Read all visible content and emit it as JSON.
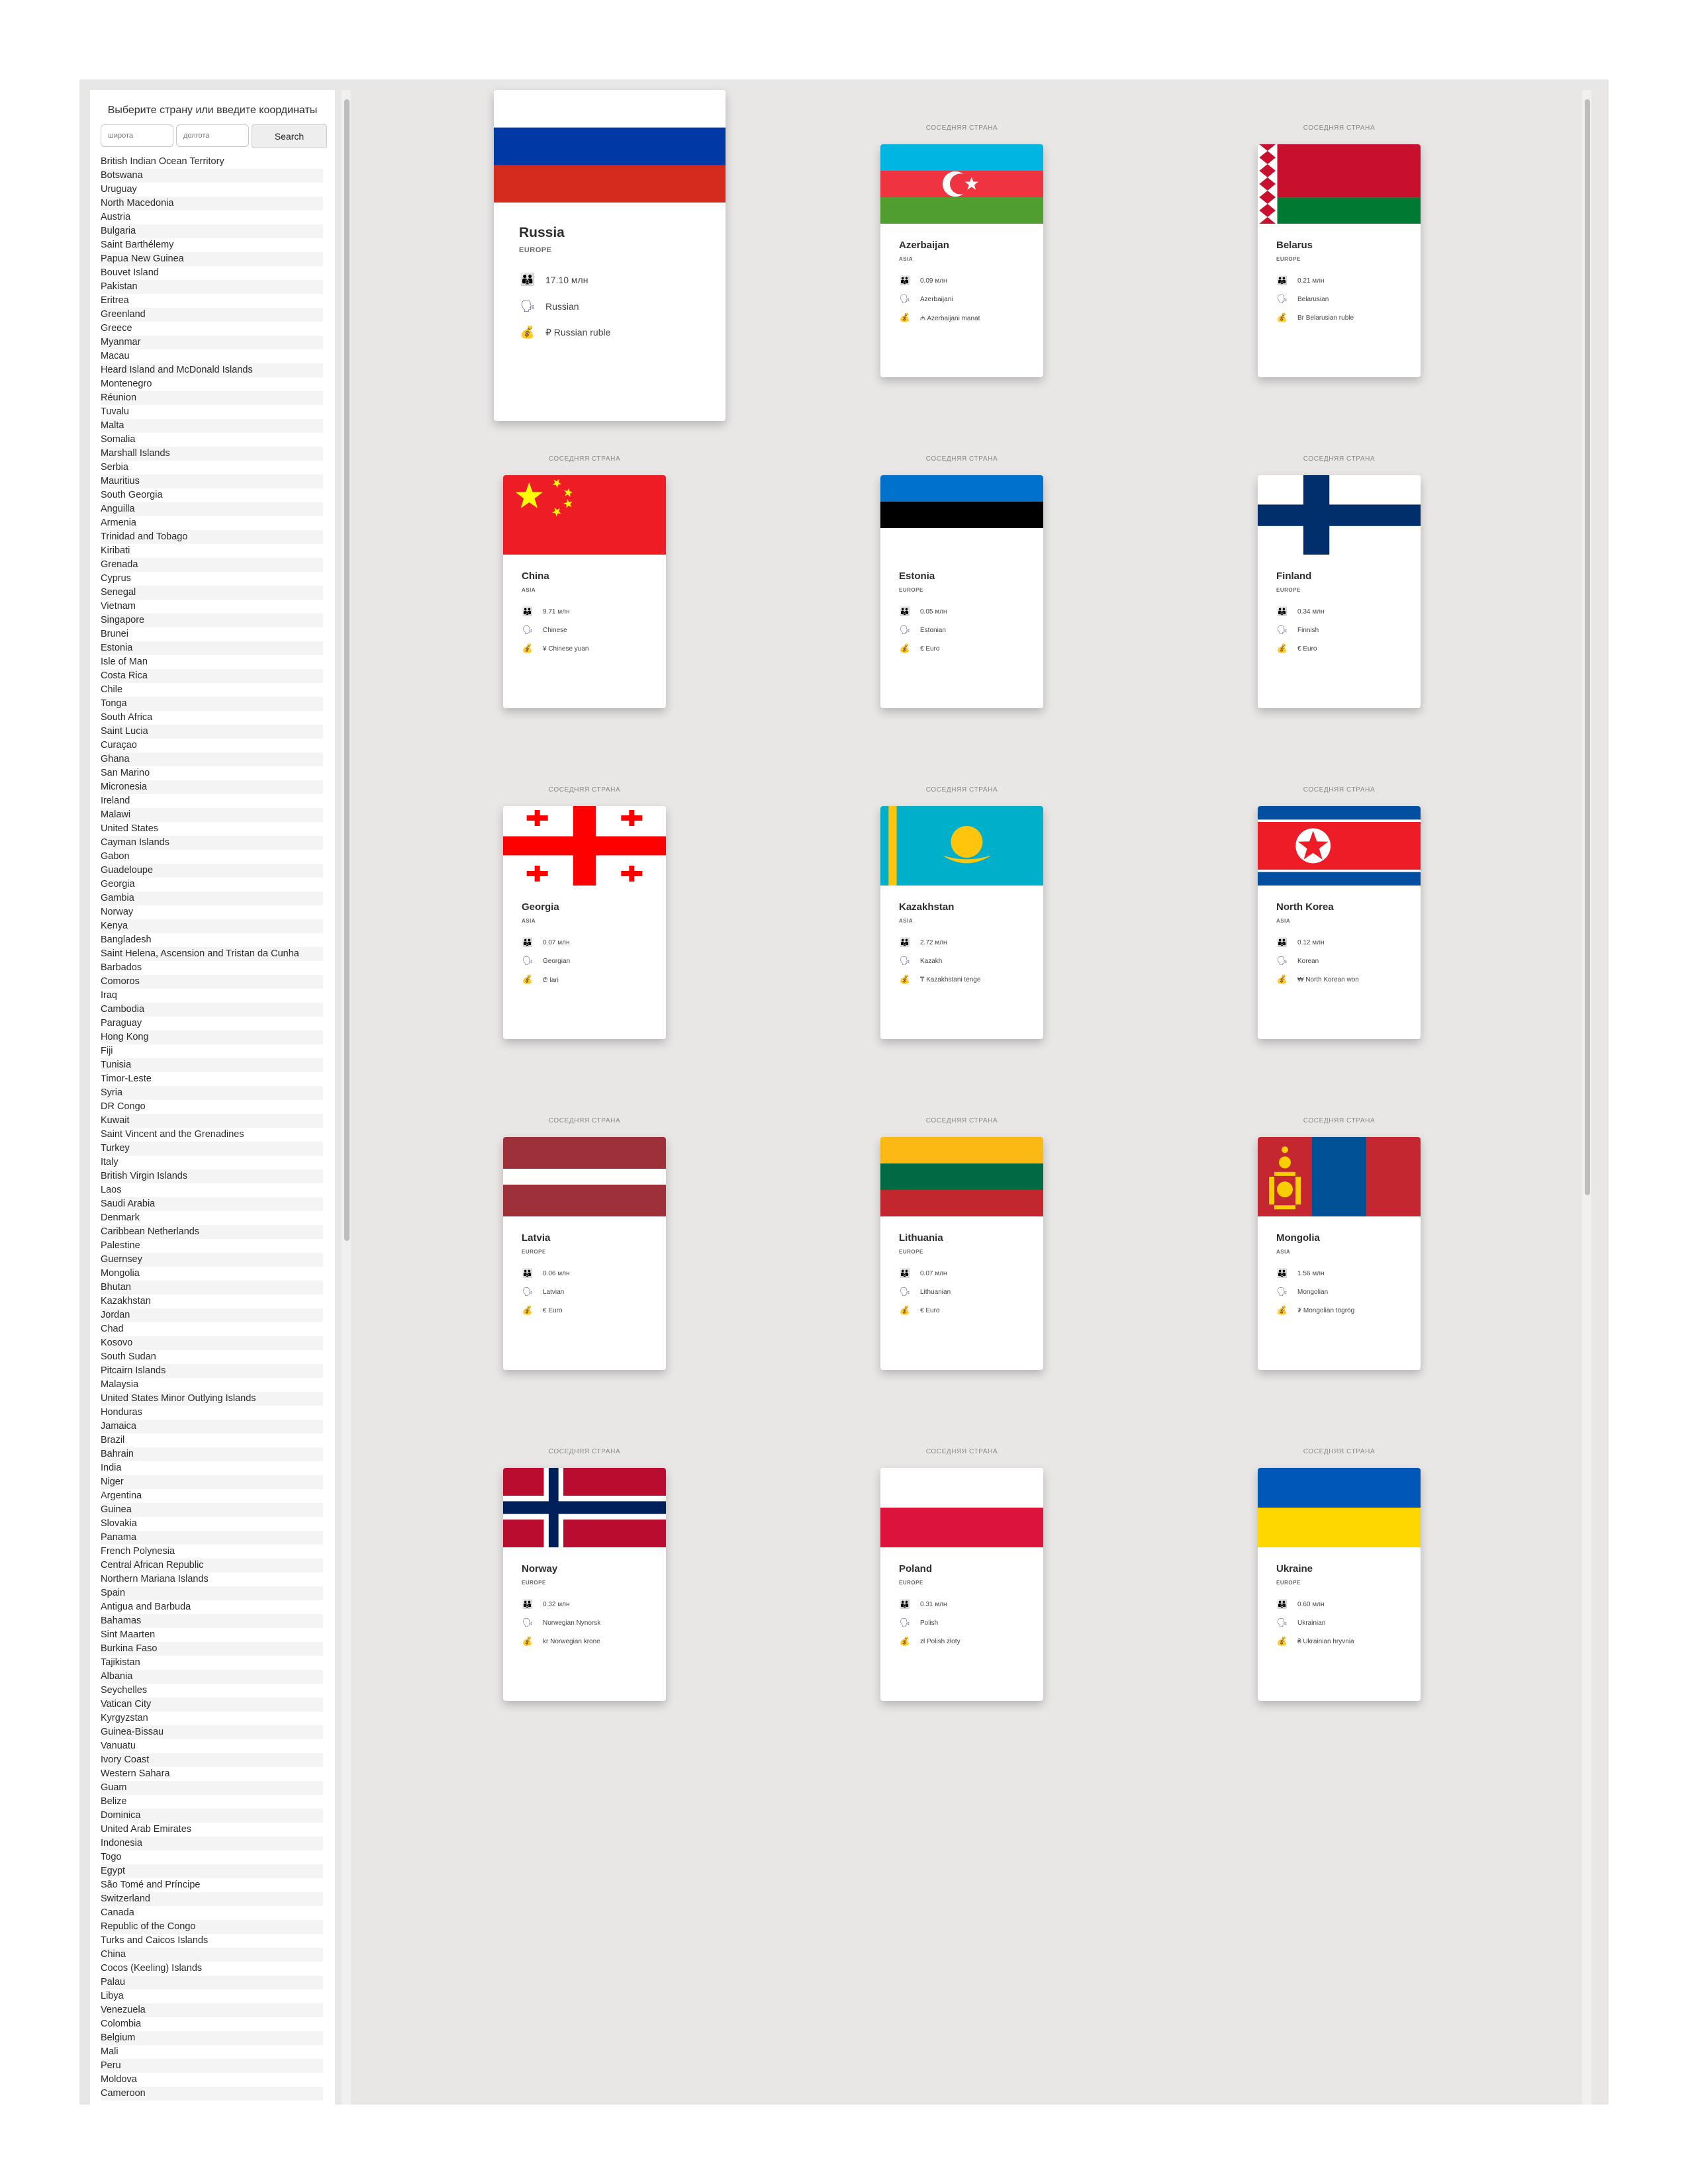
{
  "sidebar": {
    "title": "Выберите страну или введите координаты",
    "lat_placeholder": "широта",
    "lon_placeholder": "долгота",
    "search_label": "Search",
    "countries": [
      "British Indian Ocean Territory",
      "Botswana",
      "Uruguay",
      "North Macedonia",
      "Austria",
      "Bulgaria",
      "Saint Barthélemy",
      "Papua New Guinea",
      "Bouvet Island",
      "Pakistan",
      "Eritrea",
      "Greenland",
      "Greece",
      "Myanmar",
      "Macau",
      "Heard Island and McDonald Islands",
      "Montenegro",
      "Réunion",
      "Tuvalu",
      "Malta",
      "Somalia",
      "Marshall Islands",
      "Serbia",
      "Mauritius",
      "South Georgia",
      "Anguilla",
      "Armenia",
      "Trinidad and Tobago",
      "Kiribati",
      "Grenada",
      "Cyprus",
      "Senegal",
      "Vietnam",
      "Singapore",
      "Brunei",
      "Estonia",
      "Isle of Man",
      "Costa Rica",
      "Chile",
      "Tonga",
      "South Africa",
      "Saint Lucia",
      "Curaçao",
      "Ghana",
      "San Marino",
      "Micronesia",
      "Ireland",
      "Malawi",
      "United States",
      "Cayman Islands",
      "Gabon",
      "Guadeloupe",
      "Georgia",
      "Gambia",
      "Norway",
      "Kenya",
      "Bangladesh",
      "Saint Helena, Ascension and Tristan da Cunha",
      "Barbados",
      "Comoros",
      "Iraq",
      "Cambodia",
      "Paraguay",
      "Hong Kong",
      "Fiji",
      "Tunisia",
      "Timor-Leste",
      "Syria",
      "DR Congo",
      "Kuwait",
      "Saint Vincent and the Grenadines",
      "Turkey",
      "Italy",
      "British Virgin Islands",
      "Laos",
      "Saudi Arabia",
      "Denmark",
      "Caribbean Netherlands",
      "Palestine",
      "Guernsey",
      "Mongolia",
      "Bhutan",
      "Kazakhstan",
      "Jordan",
      "Chad",
      "Kosovo",
      "South Sudan",
      "Pitcairn Islands",
      "Malaysia",
      "United States Minor Outlying Islands",
      "Honduras",
      "Jamaica",
      "Brazil",
      "Bahrain",
      "India",
      "Niger",
      "Argentina",
      "Guinea",
      "Slovakia",
      "Panama",
      "French Polynesia",
      "Central African Republic",
      "Northern Mariana Islands",
      "Spain",
      "Antigua and Barbuda",
      "Bahamas",
      "Sint Maarten",
      "Burkina Faso",
      "Tajikistan",
      "Albania",
      "Seychelles",
      "Vatican City",
      "Kyrgyzstan",
      "Guinea-Bissau",
      "Vanuatu",
      "Ivory Coast",
      "Western Sahara",
      "Guam",
      "Belize",
      "Dominica",
      "United Arab Emirates",
      "Indonesia",
      "Togo",
      "Egypt",
      "São Tomé and Príncipe",
      "Switzerland",
      "Canada",
      "Republic of the Congo",
      "Turks and Caicos Islands",
      "China",
      "Cocos (Keeling) Islands",
      "Palau",
      "Libya",
      "Venezuela",
      "Colombia",
      "Belgium",
      "Mali",
      "Peru",
      "Moldova",
      "Cameroon"
    ]
  },
  "neighbor_label": "СОСЕДНЯЯ СТРАНА",
  "icons": {
    "population": "people-icon",
    "language": "speech-icon",
    "currency": "money-bag-icon"
  },
  "main_country": {
    "name": "Russia",
    "region": "EUROPE",
    "population": "17.10 млн",
    "language": "Russian",
    "currency": "₽ Russian ruble",
    "flag": {
      "type": "h",
      "colors": [
        "#ffffff",
        "#0039a6",
        "#d52b1e"
      ]
    }
  },
  "neighbors": [
    {
      "name": "Azerbaijan",
      "region": "ASIA",
      "population": "0.09 млн",
      "language": "Azerbaijani",
      "currency": "₼ Azerbaijani manat",
      "flag": {
        "type": "azerbaijan"
      }
    },
    {
      "name": "Belarus",
      "region": "EUROPE",
      "population": "0.21 млн",
      "language": "Belarusian",
      "currency": "Br Belarusian ruble",
      "flag": {
        "type": "belarus"
      }
    },
    {
      "name": "China",
      "region": "ASIA",
      "population": "9.71 млн",
      "language": "Chinese",
      "currency": "¥ Chinese yuan",
      "flag": {
        "type": "china"
      }
    },
    {
      "name": "Estonia",
      "region": "EUROPE",
      "population": "0.05 млн",
      "language": "Estonian",
      "currency": "€ Euro",
      "flag": {
        "type": "h",
        "colors": [
          "#0072ce",
          "#000000",
          "#ffffff"
        ]
      }
    },
    {
      "name": "Finland",
      "region": "EUROPE",
      "population": "0.34 млн",
      "language": "Finnish",
      "currency": "€ Euro",
      "flag": {
        "type": "finland"
      }
    },
    {
      "name": "Georgia",
      "region": "ASIA",
      "population": "0.07 млн",
      "language": "Georgian",
      "currency": "₾ lari",
      "flag": {
        "type": "georgia"
      }
    },
    {
      "name": "Kazakhstan",
      "region": "ASIA",
      "population": "2.72 млн",
      "language": "Kazakh",
      "currency": "₸ Kazakhstani tenge",
      "flag": {
        "type": "kazakhstan"
      }
    },
    {
      "name": "North Korea",
      "region": "ASIA",
      "population": "0.12 млн",
      "language": "Korean",
      "currency": "₩ North Korean won",
      "flag": {
        "type": "nkorea"
      }
    },
    {
      "name": "Latvia",
      "region": "EUROPE",
      "population": "0.06 млн",
      "language": "Latvian",
      "currency": "€ Euro",
      "flag": {
        "type": "latvia"
      }
    },
    {
      "name": "Lithuania",
      "region": "EUROPE",
      "population": "0.07 млн",
      "language": "Lithuanian",
      "currency": "€ Euro",
      "flag": {
        "type": "h",
        "colors": [
          "#fdb913",
          "#006a44",
          "#c1272d"
        ]
      }
    },
    {
      "name": "Mongolia",
      "region": "ASIA",
      "population": "1.56 млн",
      "language": "Mongolian",
      "currency": "₮ Mongolian tögrög",
      "flag": {
        "type": "mongolia"
      }
    },
    {
      "name": "Norway",
      "region": "EUROPE",
      "population": "0.32 млн",
      "language": "Norwegian Nynorsk",
      "currency": "kr Norwegian krone",
      "flag": {
        "type": "norway"
      }
    },
    {
      "name": "Poland",
      "region": "EUROPE",
      "population": "0.31 млн",
      "language": "Polish",
      "currency": "zł Polish złoty",
      "flag": {
        "type": "h",
        "colors": [
          "#ffffff",
          "#dc143c"
        ]
      }
    },
    {
      "name": "Ukraine",
      "region": "EUROPE",
      "population": "0.60 млн",
      "language": "Ukrainian",
      "currency": "₴ Ukrainian hryvnia",
      "flag": {
        "type": "h",
        "colors": [
          "#0057b7",
          "#ffd700"
        ]
      }
    }
  ]
}
